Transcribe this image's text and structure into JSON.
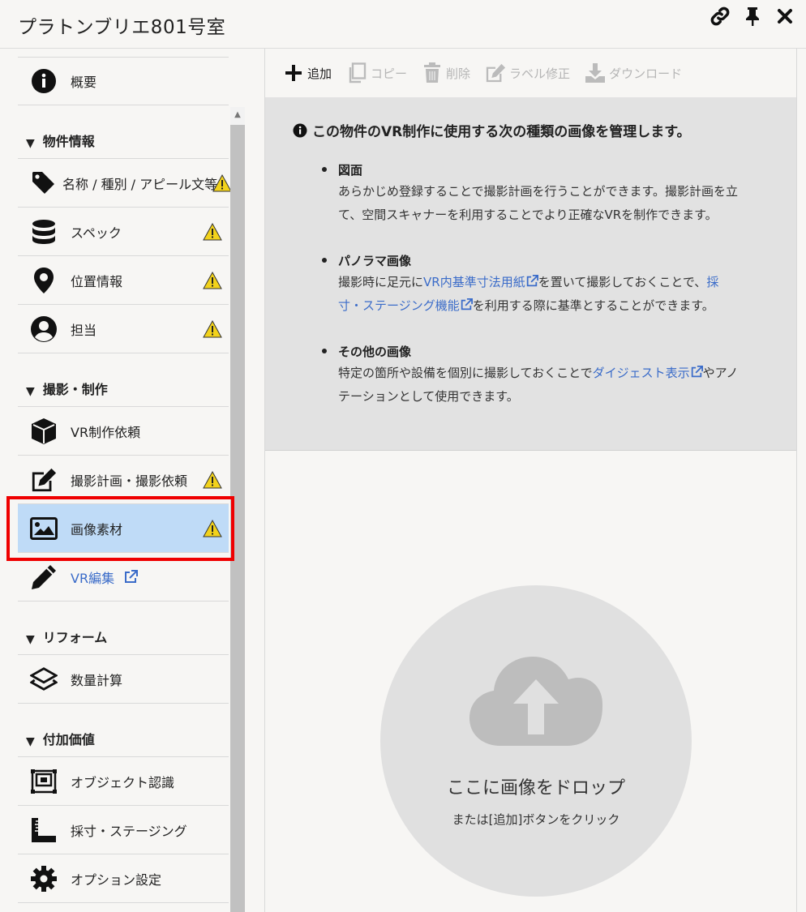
{
  "window": {
    "title": "プラトンブリエ801号室"
  },
  "sidebar": {
    "overview": "概要",
    "sections": {
      "property": "物件情報",
      "shooting": "撮影・制作",
      "reform": "リフォーム",
      "added_value": "付加価値"
    },
    "items": {
      "name": "名称 / 種別 / アピール文等",
      "spec": "スペック",
      "location": "位置情報",
      "contact": "担当",
      "vr_request": "VR制作依頼",
      "shoot_plan": "撮影計画・撮影依頼",
      "images": "画像素材",
      "vr_edit": "VR編集",
      "quantity": "数量計算",
      "object_recognition": "オブジェクト認識",
      "measure_staging": "採寸・ステージング",
      "options": "オプション設定"
    },
    "active_item": "画像素材"
  },
  "toolbar": {
    "add": "追加",
    "copy": "コピー",
    "delete": "削除",
    "label_edit": "ラベル修正",
    "download": "ダウンロード"
  },
  "info": {
    "heading": "この物件のVR制作に使用する次の種類の画像を管理します。",
    "items": [
      {
        "title": "図面",
        "line1": "あらかじめ登録することで撮影計画を行うことができます。撮影計画を立",
        "line2": "て、空間スキャナーを利用することでより正確なVRを制作できます。"
      },
      {
        "title": "パノラマ画像",
        "pre": "撮影時に足元に",
        "link1": "VR内基準寸法用紙",
        "mid": "を置いて撮影しておくことで、",
        "link2a": "採",
        "link2b": "寸・ステージング機能",
        "post": "を利用する際に基準とすることができます。"
      },
      {
        "title": "その他の画像",
        "pre": "特定の箇所や設備を個別に撮影しておくことで",
        "link": "ダイジェスト表示",
        "post1": "やアノ",
        "post2": "テーションとして使用できます。"
      }
    ]
  },
  "dropzone": {
    "title": "ここに画像をドロップ",
    "subtitle": "または[追加]ボタンをクリック"
  },
  "colors": {
    "active_bg": "#bfdbf7",
    "highlight": "#ef0000",
    "link": "#3b6cc9",
    "warning": "#f2d21b"
  }
}
